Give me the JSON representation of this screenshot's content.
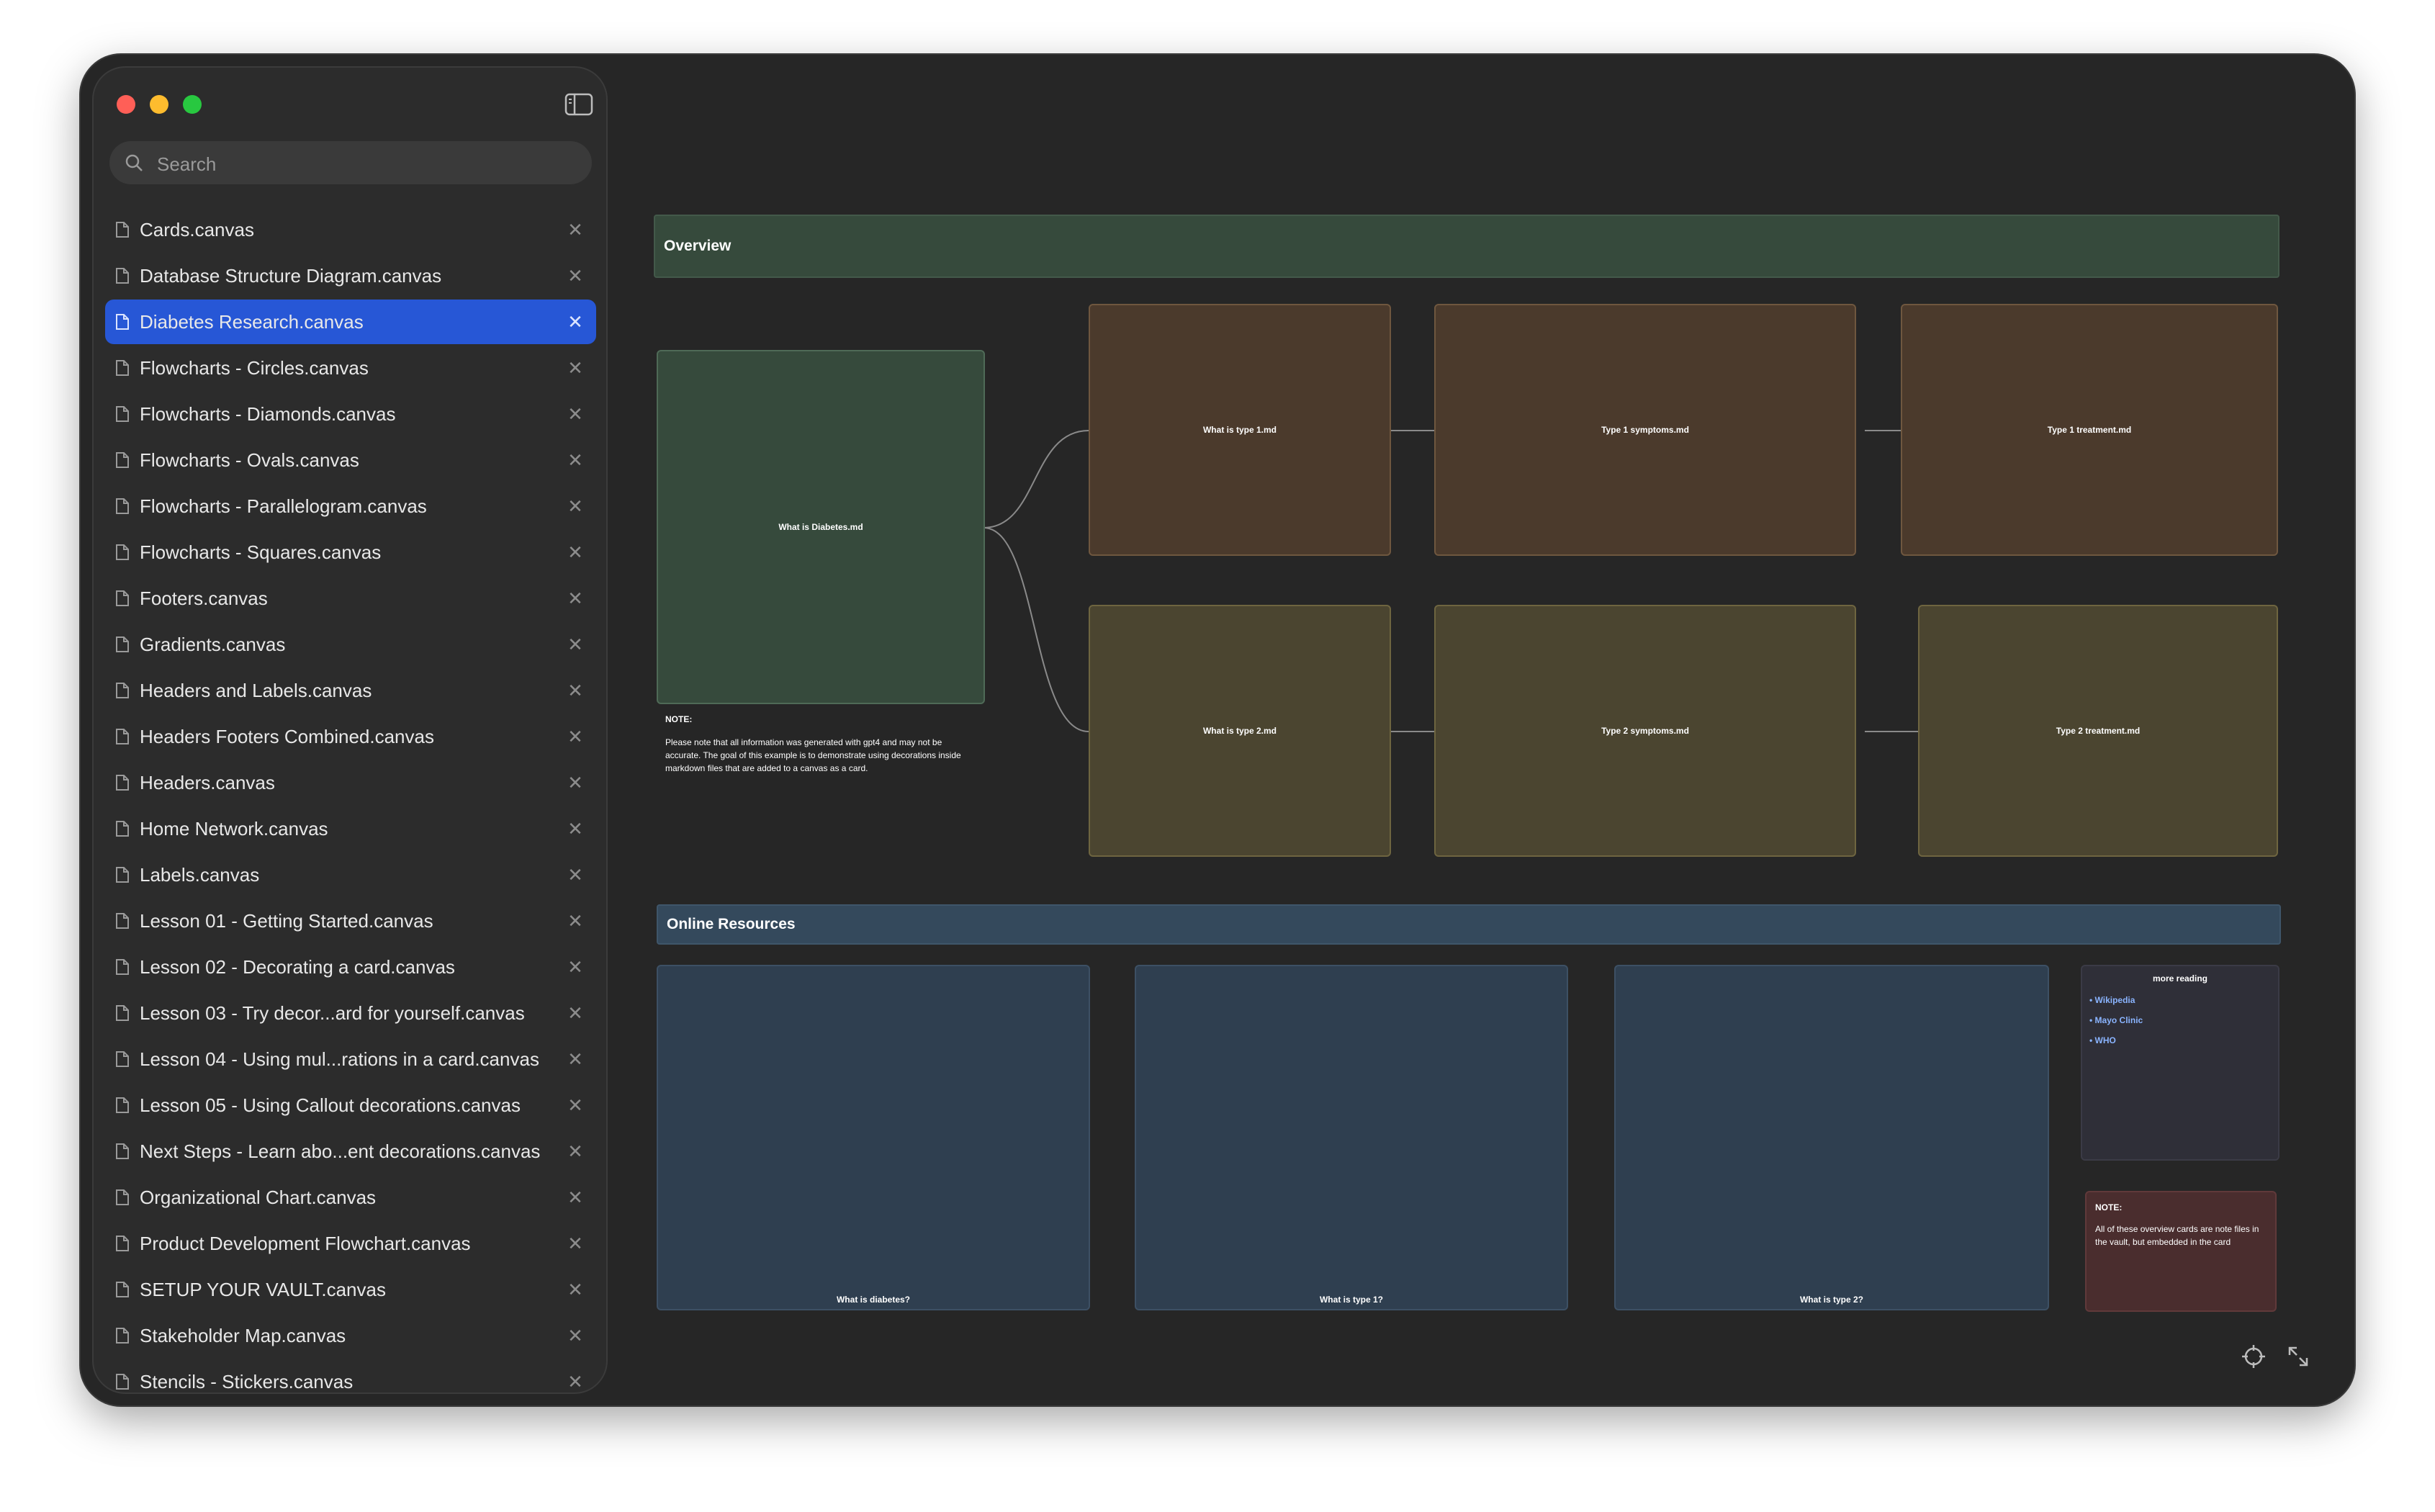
{
  "sidebar": {
    "search_placeholder": "Search",
    "items": [
      {
        "label": "Cards.canvas",
        "active": false
      },
      {
        "label": "Database Structure Diagram.canvas",
        "active": false
      },
      {
        "label": "Diabetes Research.canvas",
        "active": true
      },
      {
        "label": "Flowcharts - Circles.canvas",
        "active": false
      },
      {
        "label": "Flowcharts - Diamonds.canvas",
        "active": false
      },
      {
        "label": "Flowcharts - Ovals.canvas",
        "active": false
      },
      {
        "label": "Flowcharts - Parallelogram.canvas",
        "active": false
      },
      {
        "label": "Flowcharts - Squares.canvas",
        "active": false
      },
      {
        "label": "Footers.canvas",
        "active": false
      },
      {
        "label": "Gradients.canvas",
        "active": false
      },
      {
        "label": "Headers and Labels.canvas",
        "active": false
      },
      {
        "label": "Headers Footers Combined.canvas",
        "active": false
      },
      {
        "label": "Headers.canvas",
        "active": false
      },
      {
        "label": "Home Network.canvas",
        "active": false
      },
      {
        "label": "Labels.canvas",
        "active": false
      },
      {
        "label": "Lesson 01 - Getting Started.canvas",
        "active": false
      },
      {
        "label": "Lesson 02 - Decorating a card.canvas",
        "active": false
      },
      {
        "label": "Lesson 03 - Try decor...ard for yourself.canvas",
        "active": false
      },
      {
        "label": "Lesson 04 - Using mul...rations in a card.canvas",
        "active": false
      },
      {
        "label": "Lesson 05 - Using Callout decorations.canvas",
        "active": false
      },
      {
        "label": "Next Steps - Learn abo...ent decorations.canvas",
        "active": false
      },
      {
        "label": "Organizational Chart.canvas",
        "active": false
      },
      {
        "label": "Product Development Flowchart.canvas",
        "active": false
      },
      {
        "label": "SETUP YOUR VAULT.canvas",
        "active": false
      },
      {
        "label": "Stakeholder Map.canvas",
        "active": false
      },
      {
        "label": "Stencils - Stickers.canvas",
        "active": false
      }
    ]
  },
  "canvas": {
    "overview_label": "Overview",
    "online_label": "Online Resources",
    "cards": {
      "what_is_diabetes": "What is Diabetes.md",
      "what_is_type1": "What is type 1.md",
      "type1_symptoms": "Type 1 symptoms.md",
      "type1_treatment": "Type 1 treatment.md",
      "what_is_type2": "What is type 2.md",
      "type2_symptoms": "Type 2 symptoms.md",
      "type2_treatment": "Type 2 treatment.md",
      "online_1": "What is diabetes?",
      "online_2": "What is type 1?",
      "online_3": "What is type 2?"
    },
    "note1": {
      "title": "NOTE:",
      "body": " Please note that all information was generated with gpt4 and may not be accurate. The goal of this example is to demonstrate using decorations inside markdown files that are added to a canvas as a card."
    },
    "more_reading": {
      "title": "more reading",
      "links": [
        "• Wikipedia",
        "• Mayo Clinic",
        "• WHO"
      ]
    },
    "note2": {
      "title": "NOTE:",
      "body": " All of these overview cards are note files in the vault, but embedded in the card"
    }
  },
  "colors": {
    "accent": "#2757d6",
    "window_bg": "#262626",
    "sidebar_bg": "#2c2c2c"
  },
  "icons": [
    "sidebar-toggle-icon",
    "search-icon",
    "file-icon",
    "close-icon",
    "recenter-icon",
    "fullscreen-icon"
  ]
}
